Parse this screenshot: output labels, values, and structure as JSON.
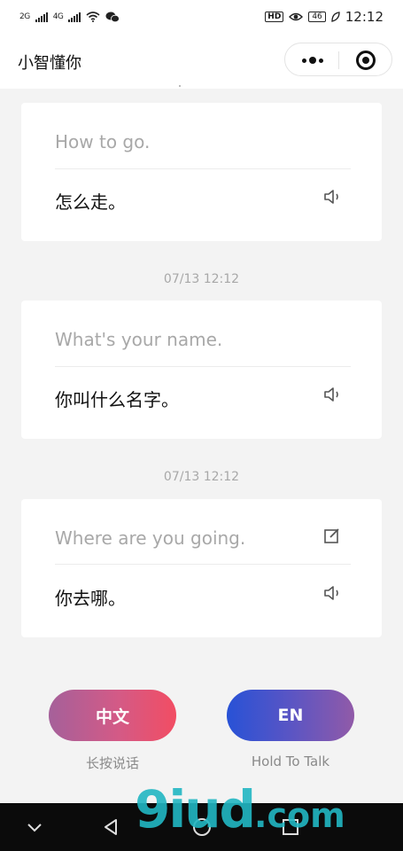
{
  "status_bar": {
    "sim1": "2G",
    "sim2": "4G",
    "hd": "HD",
    "battery": "46",
    "time": "12:12"
  },
  "nav": {
    "title": "小智懂你"
  },
  "conversation": [
    {
      "source": "How to go.",
      "translation": "怎么走。"
    },
    {
      "timestamp": "07/13 12:12",
      "source": "What's your name.",
      "translation": "你叫什么名字。"
    },
    {
      "timestamp": "07/13 12:12",
      "source": "Where are you going.",
      "translation": "你去哪。"
    }
  ],
  "controls": {
    "chinese_button": "中文",
    "chinese_caption": "长按说话",
    "english_button": "EN",
    "english_caption": "Hold To Talk"
  },
  "watermark": {
    "text": "9iud",
    "suffix": ".com"
  },
  "icons": {
    "speaker": "speaker-icon",
    "edit": "edit-icon",
    "more": "more-dots-icon",
    "close": "close-target-icon"
  },
  "colors": {
    "zh_gradient": [
      "#a5609a",
      "#f24d63"
    ],
    "en_gradient": [
      "#2852d6",
      "#915aa8"
    ],
    "background": "#f3f3f3"
  }
}
